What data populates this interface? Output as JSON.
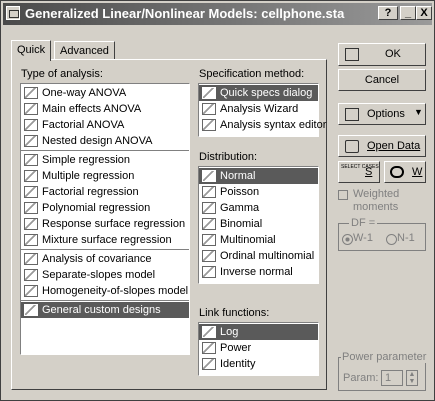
{
  "window": {
    "title": "Generalized Linear/Nonlinear Models: cellphone.sta",
    "help": "?",
    "minimize": "_",
    "close": "X"
  },
  "tabs": [
    {
      "label": "Quick"
    },
    {
      "label": "Advanced"
    }
  ],
  "type_of_analysis": {
    "label": "Type of analysis:",
    "groups": [
      [
        {
          "label": "One-way ANOVA",
          "icon": "one-way-anova-icon"
        },
        {
          "label": "Main effects ANOVA",
          "icon": "main-effects-icon"
        },
        {
          "label": "Factorial ANOVA",
          "icon": "factorial-icon"
        },
        {
          "label": "Nested design ANOVA",
          "icon": "nested-icon"
        }
      ],
      [
        {
          "label": "Simple regression",
          "icon": "simple-regression-icon"
        },
        {
          "label": "Multiple regression",
          "icon": "multiple-regression-icon"
        },
        {
          "label": "Factorial regression",
          "icon": "factorial-regression-icon"
        },
        {
          "label": "Polynomial regression",
          "icon": "polynomial-regression-icon"
        },
        {
          "label": "Response surface regression",
          "icon": "response-surface-icon"
        },
        {
          "label": "Mixture surface regression",
          "icon": "mixture-surface-icon"
        }
      ],
      [
        {
          "label": "Analysis of covariance",
          "icon": "covariance-icon"
        },
        {
          "label": "Separate-slopes model",
          "icon": "separate-slopes-icon"
        },
        {
          "label": "Homogeneity-of-slopes model",
          "icon": "homogeneity-icon"
        }
      ],
      [
        {
          "label": "General custom designs",
          "icon": "custom-designs-icon",
          "selected": true
        }
      ]
    ]
  },
  "specification": {
    "label": "Specification method:",
    "items": [
      {
        "label": "Quick specs dialog",
        "icon": "quick-specs-icon",
        "selected": true
      },
      {
        "label": "Analysis Wizard",
        "icon": "wizard-icon"
      },
      {
        "label": "Analysis syntax editor",
        "icon": "syntax-editor-icon"
      }
    ]
  },
  "distribution": {
    "label": "Distribution:",
    "items": [
      {
        "label": "Normal",
        "icon": "normal-dist-icon",
        "selected": true
      },
      {
        "label": "Poisson",
        "icon": "poisson-dist-icon"
      },
      {
        "label": "Gamma",
        "icon": "gamma-dist-icon"
      },
      {
        "label": "Binomial",
        "icon": "binomial-dist-icon"
      },
      {
        "label": "Multinomial",
        "icon": "multinomial-dist-icon"
      },
      {
        "label": "Ordinal multinomial",
        "icon": "ordinal-dist-icon"
      },
      {
        "label": "Inverse normal",
        "icon": "inverse-normal-dist-icon"
      }
    ]
  },
  "link_functions": {
    "label": "Link functions:",
    "items": [
      {
        "label": "Log",
        "icon": "log-link-icon",
        "selected": true
      },
      {
        "label": "Power",
        "icon": "power-link-icon"
      },
      {
        "label": "Identity",
        "icon": "identity-link-icon"
      }
    ]
  },
  "side": {
    "ok": "OK",
    "cancel": "Cancel",
    "options": "Options",
    "open_data": "Open Data",
    "select_cases": "SELECT CASES",
    "select_s": "S",
    "weight_w": "W",
    "weighted_moments": "Weighted moments",
    "df_label": "DF =",
    "df_w1": "W-1",
    "df_n1": "N-1",
    "power_param_label": "Power parameter",
    "param_label": "Param:",
    "param_value": "1"
  }
}
